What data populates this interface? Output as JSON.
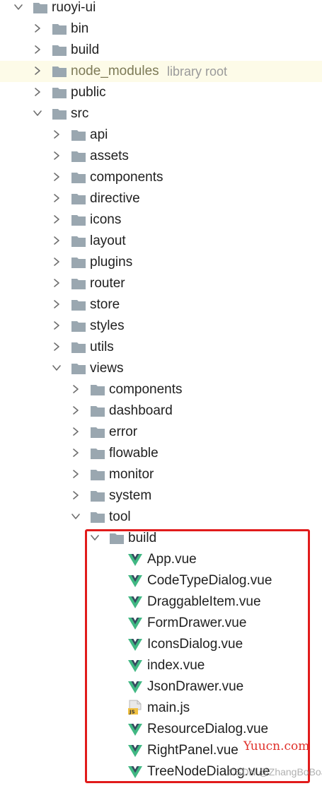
{
  "project_tree": {
    "root": {
      "label": "ruoyi-ui"
    },
    "bin": {
      "label": "bin"
    },
    "build": {
      "label": "build"
    },
    "node_modules": {
      "label": "node_modules",
      "hint": "library root"
    },
    "public": {
      "label": "public"
    },
    "src": {
      "label": "src",
      "api": "api",
      "assets": "assets",
      "components": "components",
      "directive": "directive",
      "icons": "icons",
      "layout": "layout",
      "plugins": "plugins",
      "router": "router",
      "store": "store",
      "styles": "styles",
      "utils": "utils",
      "views": {
        "label": "views",
        "components": "components",
        "dashboard": "dashboard",
        "error": "error",
        "flowable": "flowable",
        "monitor": "monitor",
        "system": "system",
        "tool": {
          "label": "tool",
          "build": {
            "label": "build",
            "files": [
              {
                "name": "App.vue",
                "icon": "vue-icon"
              },
              {
                "name": "CodeTypeDialog.vue",
                "icon": "vue-icon"
              },
              {
                "name": "DraggableItem.vue",
                "icon": "vue-icon"
              },
              {
                "name": "FormDrawer.vue",
                "icon": "vue-icon"
              },
              {
                "name": "IconsDialog.vue",
                "icon": "vue-icon"
              },
              {
                "name": "index.vue",
                "icon": "vue-icon"
              },
              {
                "name": "JsonDrawer.vue",
                "icon": "vue-icon"
              },
              {
                "name": "main.js",
                "icon": "js-file-icon"
              },
              {
                "name": "ResourceDialog.vue",
                "icon": "vue-icon"
              },
              {
                "name": "RightPanel.vue",
                "icon": "vue-icon"
              },
              {
                "name": "TreeNodeDialog.vue",
                "icon": "vue-icon"
              }
            ]
          }
        }
      }
    }
  },
  "colors": {
    "folder": "#9aa7b0",
    "vue_green": "#41b883",
    "vue_dark": "#35495e",
    "highlight_row": "#fdfbe8",
    "selection_box": "#e11b1b",
    "js_badge": "#f0c040"
  },
  "watermarks": {
    "site": "Yuucn.com",
    "author": "CSDN @ZhangBoBoa"
  }
}
